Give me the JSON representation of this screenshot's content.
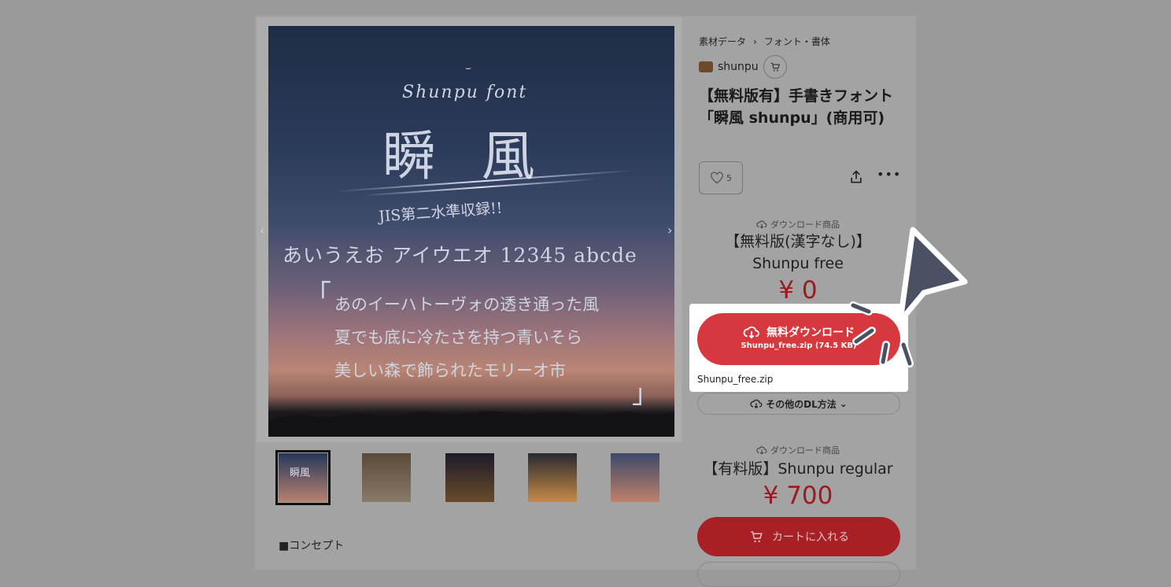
{
  "breadcrumb": {
    "category": "素材データ",
    "subcategory": "フォント・書体"
  },
  "shop": {
    "name": "shunpu",
    "cart_icon": "cart-icon"
  },
  "product_title": "【無料版有】手書きフォント「瞬風 shunpu」(商用可)",
  "likes": {
    "count": "5",
    "icon": "heart-icon"
  },
  "hero": {
    "line1": "Shunpu font",
    "line2": "瞬 風",
    "line3": "JIS第二水準収録!!",
    "line4": "あいうえお アイウエオ 12345 abcde",
    "bracket_open": "「",
    "poem1": "あのイーハトーヴォの透き通った風",
    "poem2": "夏でも底に冷たさを持つ青いそら",
    "poem3": "美しい森で飾られたモリーオ市",
    "bracket_close": "」"
  },
  "thumbnails": [
    {
      "label": "瞬風",
      "colors": [
        "#27375a",
        "#b7826e"
      ]
    },
    {
      "label": "",
      "colors": [
        "#5b4a3a",
        "#8a7a6a"
      ]
    },
    {
      "label": "",
      "colors": [
        "#1c1c2a",
        "#6a4a2a"
      ]
    },
    {
      "label": "",
      "colors": [
        "#2a2a32",
        "#c78a45"
      ]
    },
    {
      "label": "",
      "colors": [
        "#3b4a6a",
        "#c0806a"
      ]
    }
  ],
  "concept_label": "■コンセプト",
  "free_product": {
    "kind": "ダウンロード商品",
    "name_line1": "【無料版(漢字なし)】",
    "name_line2": "Shunpu free",
    "price": "¥ 0",
    "download_label": "無料ダウンロード",
    "file_info": "Shunpu_free.zip (74.5 KB)",
    "file_name": "Shunpu_free.zip",
    "other_dl": "その他のDL方法"
  },
  "paid_product": {
    "kind": "ダウンロード商品",
    "name": "【有料版】Shunpu regular",
    "price": "¥ 700",
    "cart_label": "カートに入れる"
  },
  "colors": {
    "accent": "#d6383d",
    "price": "#9b1a1f",
    "overlay": "#9a9a9a",
    "cursor": "#4a5163"
  }
}
